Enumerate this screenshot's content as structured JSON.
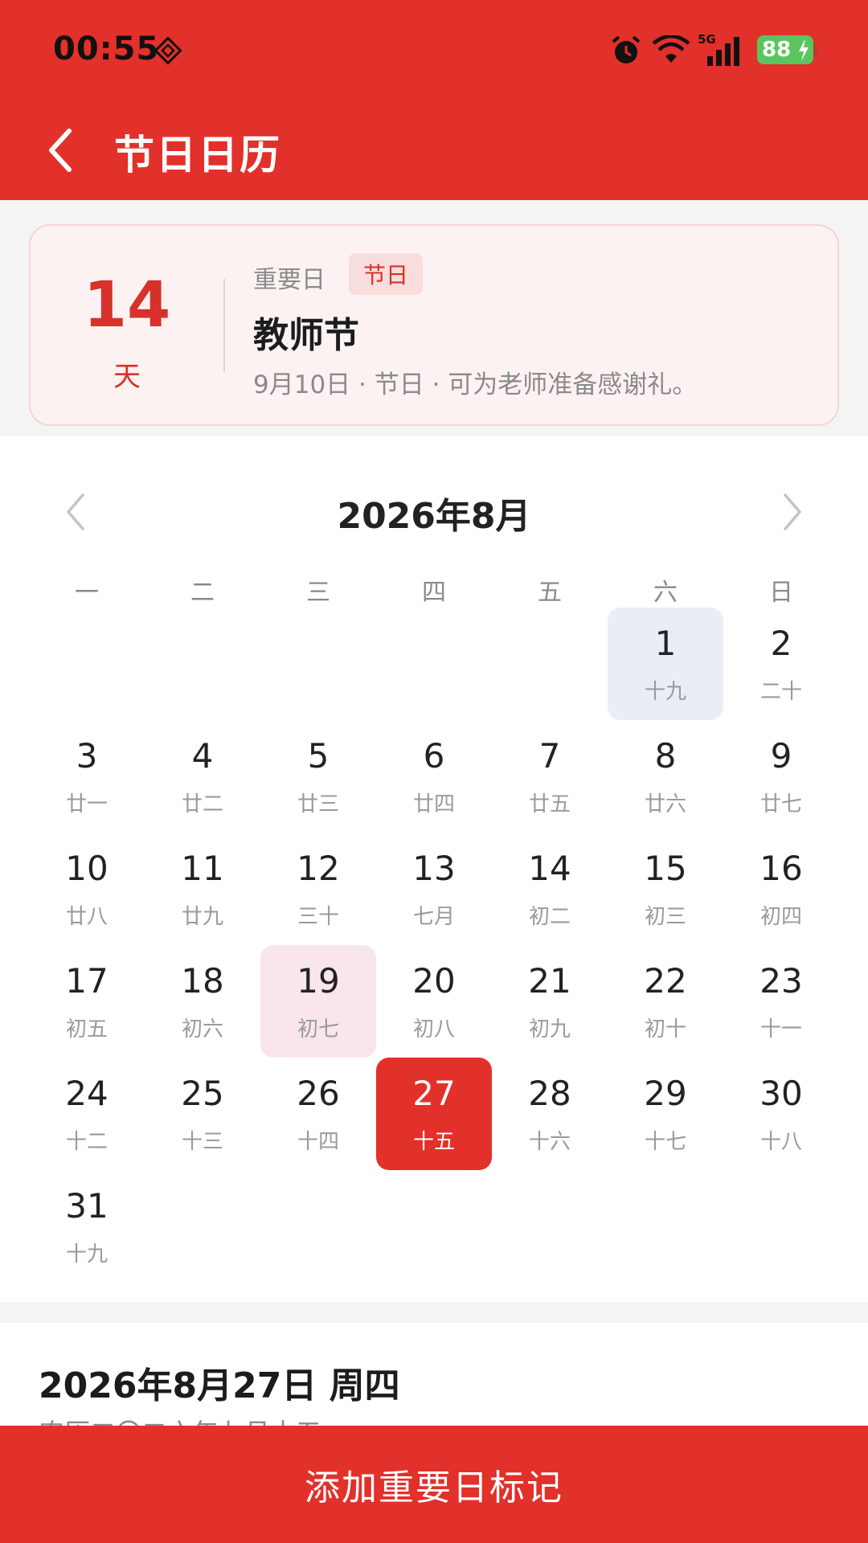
{
  "status_bar": {
    "time": "00:55",
    "network": "5G",
    "battery": "88"
  },
  "nav": {
    "title": "节日日历"
  },
  "highlight_card": {
    "days_count": "14",
    "days_unit": "天",
    "category": "重要日",
    "tag": "节日",
    "title": "教师节",
    "description": "9月10日 · 节日 · 可为老师准备感谢礼。"
  },
  "calendar": {
    "month_title": "2026年8月",
    "weekdays": [
      "一",
      "二",
      "三",
      "四",
      "五",
      "六",
      "日"
    ],
    "leading_blanks": 5,
    "days": [
      {
        "num": "1",
        "lunar": "十九",
        "style": "grey"
      },
      {
        "num": "2",
        "lunar": "二十"
      },
      {
        "num": "3",
        "lunar": "廿一"
      },
      {
        "num": "4",
        "lunar": "廿二"
      },
      {
        "num": "5",
        "lunar": "廿三"
      },
      {
        "num": "6",
        "lunar": "廿四"
      },
      {
        "num": "7",
        "lunar": "廿五"
      },
      {
        "num": "8",
        "lunar": "廿六"
      },
      {
        "num": "9",
        "lunar": "廿七"
      },
      {
        "num": "10",
        "lunar": "廿八"
      },
      {
        "num": "11",
        "lunar": "廿九"
      },
      {
        "num": "12",
        "lunar": "三十"
      },
      {
        "num": "13",
        "lunar": "七月"
      },
      {
        "num": "14",
        "lunar": "初二"
      },
      {
        "num": "15",
        "lunar": "初三"
      },
      {
        "num": "16",
        "lunar": "初四"
      },
      {
        "num": "17",
        "lunar": "初五"
      },
      {
        "num": "18",
        "lunar": "初六"
      },
      {
        "num": "19",
        "lunar": "初七",
        "style": "pink"
      },
      {
        "num": "20",
        "lunar": "初八"
      },
      {
        "num": "21",
        "lunar": "初九"
      },
      {
        "num": "22",
        "lunar": "初十"
      },
      {
        "num": "23",
        "lunar": "十一"
      },
      {
        "num": "24",
        "lunar": "十二"
      },
      {
        "num": "25",
        "lunar": "十三"
      },
      {
        "num": "26",
        "lunar": "十四"
      },
      {
        "num": "27",
        "lunar": "十五",
        "style": "selected"
      },
      {
        "num": "28",
        "lunar": "十六"
      },
      {
        "num": "29",
        "lunar": "十七"
      },
      {
        "num": "30",
        "lunar": "十八"
      },
      {
        "num": "31",
        "lunar": "十九"
      }
    ]
  },
  "selected_info": {
    "date": "2026年8月27日 周四",
    "lunar": "农历二〇二六年七月十五"
  },
  "bottom_button": {
    "label": "添加重要日标记"
  },
  "colors": {
    "brand_red": "#E2302A",
    "card_bg": "#FDF2F2",
    "highlight_grey": "#E9EEF6",
    "highlight_pink": "#F8E6EA"
  }
}
